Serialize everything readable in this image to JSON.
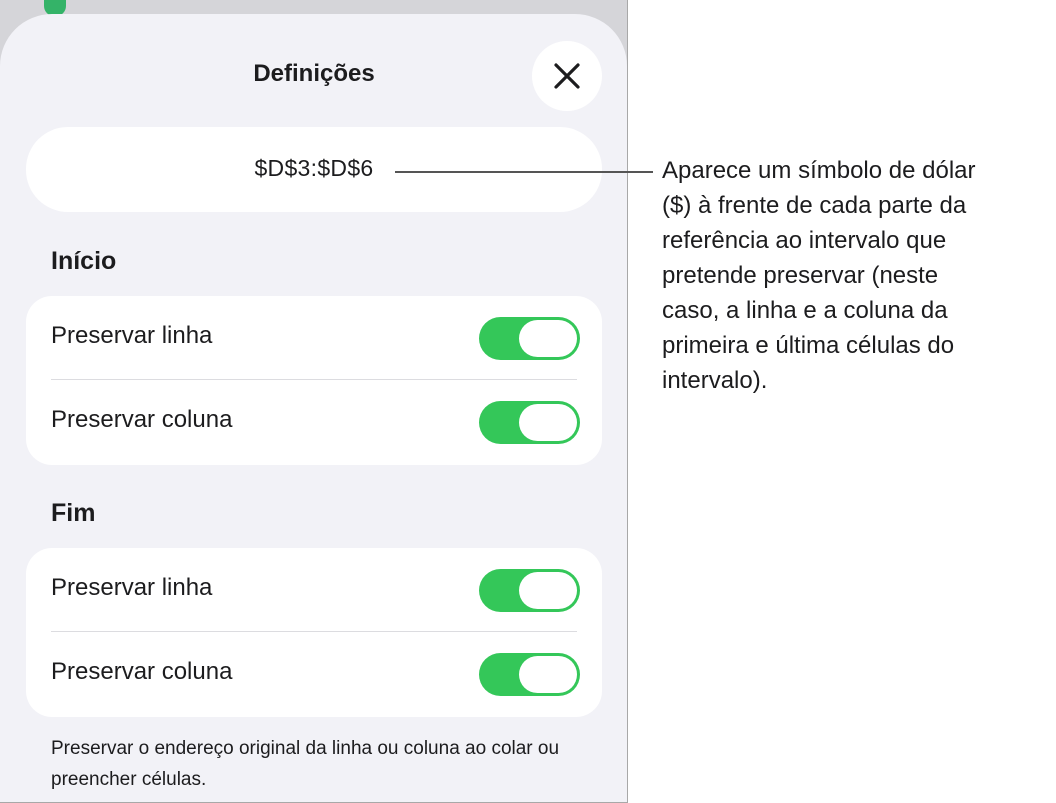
{
  "sheet": {
    "title": "Definições",
    "close_icon": "close-x-icon"
  },
  "range_field": {
    "value": "$D$3:$D$6"
  },
  "sections": [
    {
      "title": "Início",
      "rows": [
        {
          "label": "Preservar linha",
          "toggle_on": true
        },
        {
          "label": "Preservar coluna",
          "toggle_on": true
        }
      ]
    },
    {
      "title": "Fim",
      "rows": [
        {
          "label": "Preservar linha",
          "toggle_on": true
        },
        {
          "label": "Preservar coluna",
          "toggle_on": true
        }
      ]
    }
  ],
  "footer_note": "Preservar o endereço original da linha ou coluna ao colar ou preencher células.",
  "callout": {
    "lines": [
      "Aparece um símbolo de dólar",
      "($) à frente de cada parte da",
      "referência ao intervalo que",
      "pretende preservar (neste",
      "caso, a linha e a coluna da",
      "primeira e última células do",
      "intervalo)."
    ]
  },
  "colors": {
    "toggle_on": "#34c759",
    "sheet_background": "#f2f2f7",
    "backdrop": "#d5d5d9"
  }
}
